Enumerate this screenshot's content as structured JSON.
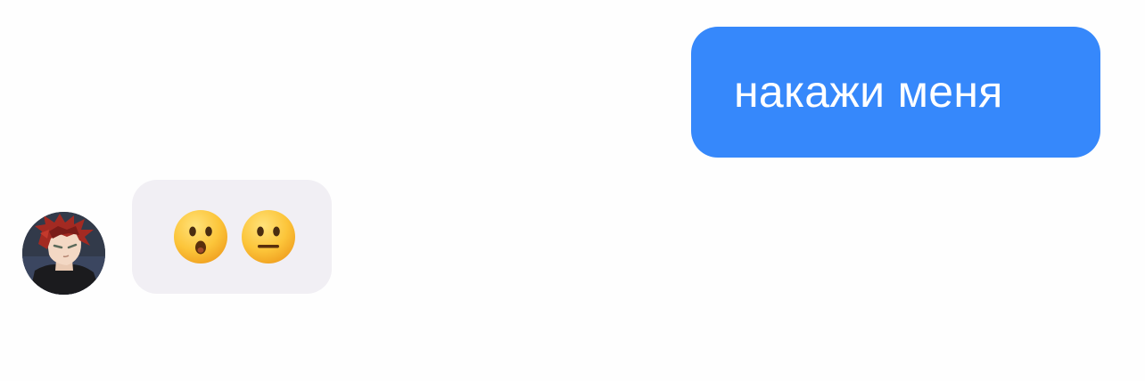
{
  "conversation": {
    "outgoing": [
      {
        "text": "накажи меня",
        "color": "#3688fb"
      }
    ],
    "incoming": [
      {
        "sender_avatar": "avatar-red-hair-character",
        "emojis": [
          "hushed-face-emoji",
          "neutral-face-emoji"
        ],
        "bubble_color": "#f1eff4"
      }
    ]
  }
}
